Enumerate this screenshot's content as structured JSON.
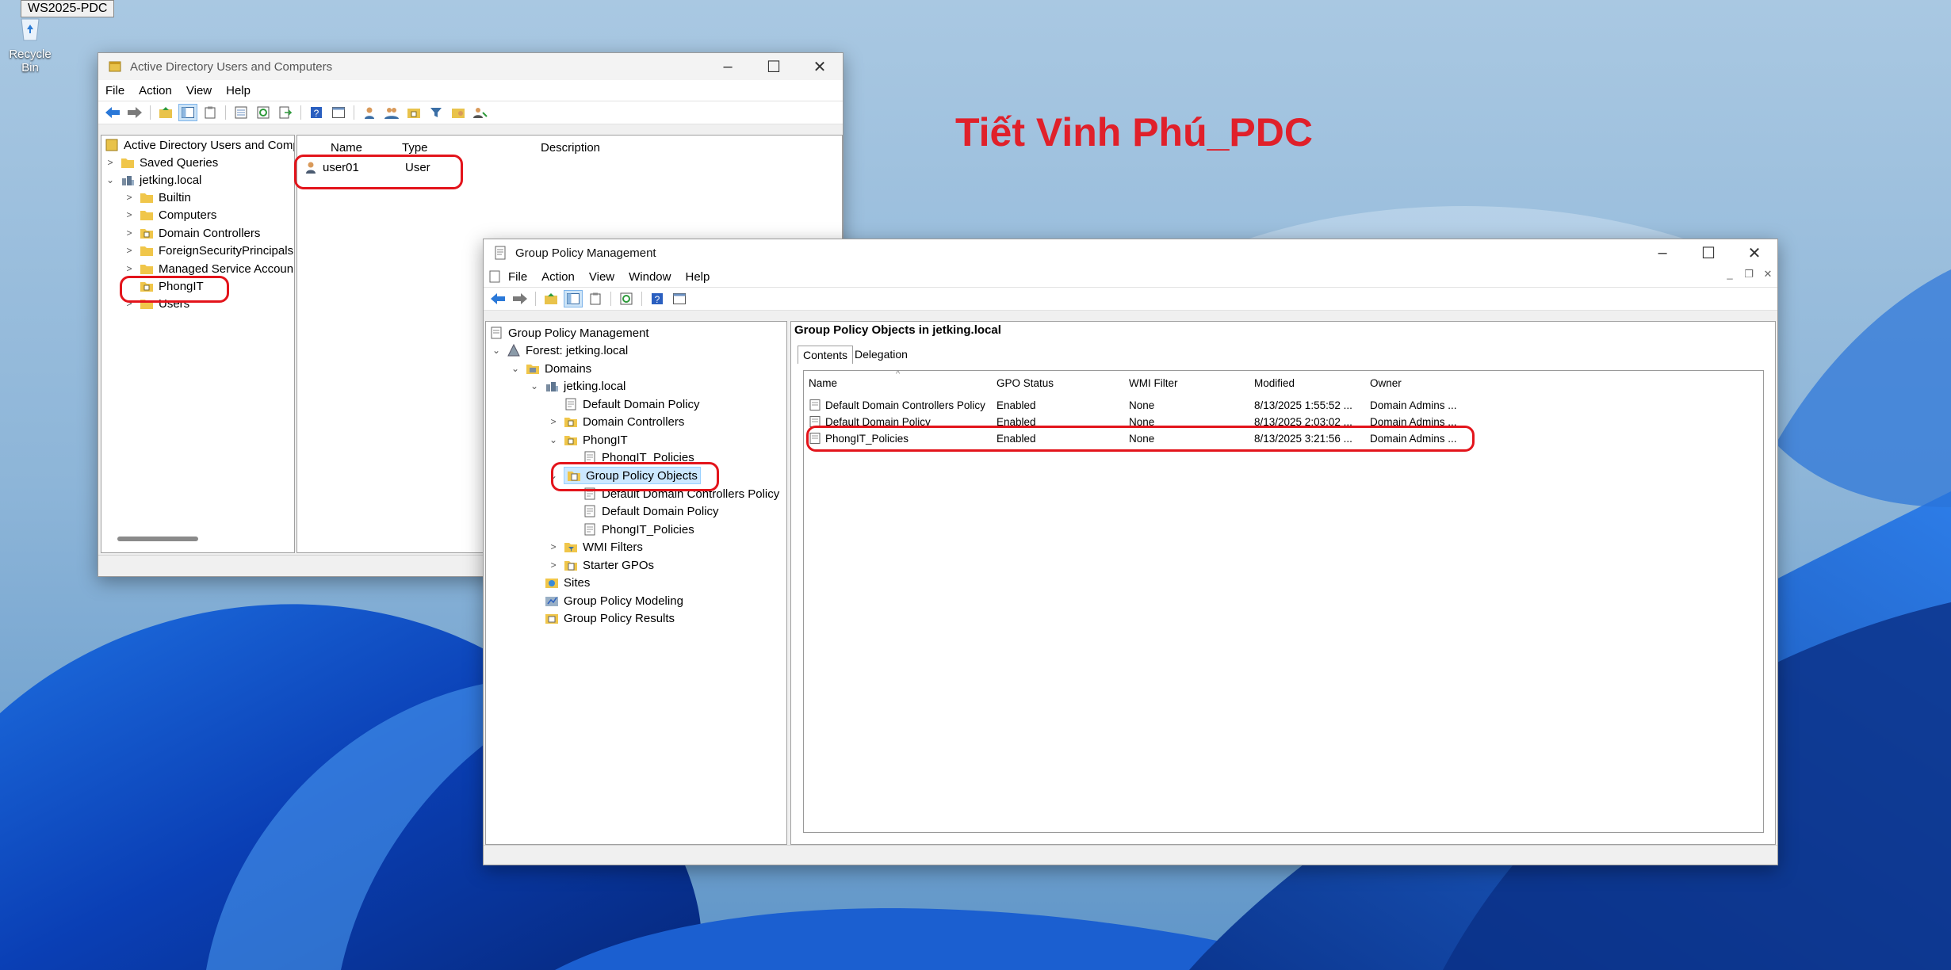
{
  "desktop": {
    "top_label": "WS2025-PDC",
    "recycle_bin": "Recycle Bin",
    "watermark": "Tiết Vinh Phú_PDC"
  },
  "aduc": {
    "title": "Active Directory Users and Computers",
    "menu": [
      "File",
      "Action",
      "View",
      "Help"
    ],
    "tree": {
      "root": "Active Directory Users and Comp",
      "saved_queries": "Saved Queries",
      "domain": "jetking.local",
      "builtin": "Builtin",
      "computers": "Computers",
      "domain_controllers": "Domain Controllers",
      "foreign": "ForeignSecurityPrincipals",
      "managed": "Managed Service Accoun",
      "phongit": "PhongIT",
      "users": "Users"
    },
    "columns": {
      "name": "Name",
      "type": "Type",
      "description": "Description"
    },
    "rows": [
      {
        "name": "user01",
        "type": "User"
      }
    ]
  },
  "gpm": {
    "title": "Group Policy Management",
    "menu": [
      "File",
      "Action",
      "View",
      "Window",
      "Help"
    ],
    "tree": {
      "root": "Group Policy Management",
      "forest": "Forest: jetking.local",
      "domains": "Domains",
      "domain": "jetking.local",
      "default_domain_policy": "Default Domain Policy",
      "domain_controllers": "Domain Controllers",
      "phongit": "PhongIT",
      "phongit_policies_link": "PhongIT_Policies",
      "gpo": "Group Policy Objects",
      "gpo_ddcp": "Default Domain Controllers Policy",
      "gpo_ddp": "Default Domain Policy",
      "gpo_phongit": "PhongIT_Policies",
      "wmi_filters": "WMI Filters",
      "starter_gpos": "Starter GPOs",
      "sites": "Sites",
      "modeling": "Group Policy Modeling",
      "results": "Group Policy Results"
    },
    "panel_title": "Group Policy Objects in jetking.local",
    "tabs": [
      "Contents",
      "Delegation"
    ],
    "columns": {
      "name": "Name",
      "status": "GPO Status",
      "wmi": "WMI Filter",
      "modified": "Modified",
      "owner": "Owner"
    },
    "rows": [
      {
        "name": "Default Domain Controllers Policy",
        "status": "Enabled",
        "wmi": "None",
        "modified": "8/13/2025 1:55:52 ...",
        "owner": "Domain Admins ..."
      },
      {
        "name": "Default Domain Policy",
        "status": "Enabled",
        "wmi": "None",
        "modified": "8/13/2025 2:03:02 ...",
        "owner": "Domain Admins ..."
      },
      {
        "name": "PhongIT_Policies",
        "status": "Enabled",
        "wmi": "None",
        "modified": "8/13/2025 3:21:56 ...",
        "owner": "Domain Admins ..."
      }
    ]
  },
  "colors": {
    "highlight": "#e3141b",
    "selection": "#cce8ff",
    "watermark": "#e0202a"
  }
}
